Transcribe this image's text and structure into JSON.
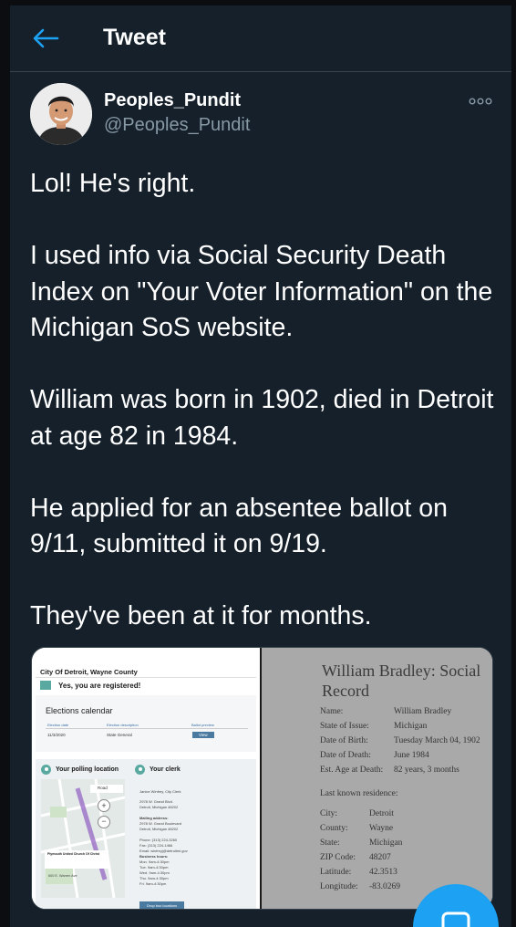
{
  "header": {
    "title": "Tweet"
  },
  "author": {
    "name": "Peoples_Pundit",
    "handle": "@Peoples_Pundit"
  },
  "tweet_paragraphs": [
    "Lol! He's right.",
    "I used info via Social Security Death Index on \"Your Voter Information\" on the Michigan SoS website.",
    "William was born in 1902, died in Detroit at age 82 in 1984.",
    "He applied for an absentee ballot on 9/11, submitted it on 9/19.",
    "They've been at it for months."
  ],
  "left_image": {
    "city": "City Of Detroit, Wayne County",
    "registered": "Yes, you are registered!",
    "elections_title": "Elections calendar",
    "col_date": "Election date",
    "col_desc": "Election description",
    "col_preview": "Ballot preview",
    "election_date": "11/3/2020",
    "election_desc": "State General",
    "view_button": "View",
    "polling_title": "Your polling location",
    "clerk_title": "Your clerk",
    "map_road": "Road",
    "map_place": "Plymouth United Church Of Christ",
    "map_address": "600 E. Warren Ave",
    "clerk_name": "Janice Winfrey, City Clerk",
    "clerk_addr1": "2978 W. Grand Blvd.",
    "clerk_addr2": "Detroit, Michigan 48202",
    "mailing_label": "Mailing address:",
    "mailing1": "2978 W. Grand Boulevard",
    "mailing2": "Detroit, Michigan 48202",
    "phone": "Phone: (313) 224-3260",
    "fax": "Fax: (313) 224-1466",
    "email": "Email: winfreyj@detroitmi.gov",
    "hours_label": "Business hours:",
    "hours": [
      "Mon. 9am-4:30pm",
      "Tue. 9am-4:30pm",
      "Wed. 9am-4:30pm",
      "Thu. 9am-4:30pm",
      "Fri. 9am-4:30pm"
    ],
    "dropbox_button": "Drop box locations"
  },
  "right_image": {
    "title": "William Bradley: Social Record",
    "rows": [
      {
        "label": "Name:",
        "value": "William Bradley"
      },
      {
        "label": "State of Issue:",
        "value": "Michigan"
      },
      {
        "label": "Date of Birth:",
        "value": "Tuesday March 04, 1902"
      },
      {
        "label": "Date of Death:",
        "value": "June 1984"
      },
      {
        "label": "Est. Age at Death:",
        "value": "82 years, 3 months"
      }
    ],
    "residence_title": "Last known residence:",
    "residence": [
      {
        "label": "City:",
        "value": "Detroit"
      },
      {
        "label": "County:",
        "value": "Wayne"
      },
      {
        "label": "State:",
        "value": "Michigan"
      },
      {
        "label": "ZIP Code:",
        "value": "48207"
      },
      {
        "label": "Latitude:",
        "value": "42.3513"
      },
      {
        "label": "Longitude:",
        "value": "-83.0269"
      }
    ]
  },
  "colors": {
    "background": "#15202b",
    "accent": "#1da1f2",
    "secondary_text": "#8899a6"
  },
  "icons": {
    "back": "arrow-left-icon",
    "more": "more-dots-icon",
    "compose": "compose-icon"
  }
}
